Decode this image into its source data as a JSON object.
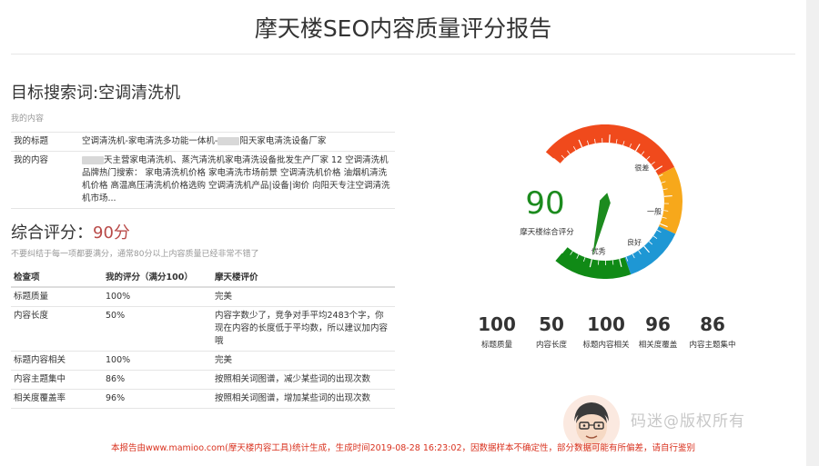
{
  "title": "摩天楼SEO内容质量评分报告",
  "keyword": {
    "label": "目标搜索词",
    "value": "空调清洗机"
  },
  "my_content_note": "我的内容",
  "content": {
    "title_label": "我的标题",
    "title_before": "空调清洗机-家电清洗多功能一体机-",
    "title_after": "阳天家电清洗设备厂家",
    "body_label": "我的内容",
    "body_before": "",
    "body_after": "天主营家电清洗机、蒸汽清洗机家电清洗设备批发生产厂家 12 空调清洗机品牌热门搜索： 家电清洗机价格 家电清洗市场前景 空调清洗机价格 油烟机清洗机价格 高温高压清洗机价格选购 空调清洗机产品|设备|询价 向阳天专注空调清洗机市场..."
  },
  "summary": {
    "label": "综合评分：",
    "value": "90分",
    "note": "不要纠结于每一项都要满分，通常80分以上内容质量已经非常不错了"
  },
  "table": {
    "headers": [
      "检查项",
      "我的评分（满分100）",
      "摩天楼评价"
    ],
    "rows": [
      {
        "item": "标题质量",
        "score": "100%",
        "comment": "完美"
      },
      {
        "item": "内容长度",
        "score": "50%",
        "comment": "内容字数少了，竞争对手平均2483个字，你现在内容的长度低于平均数，所以建议加内容哦"
      },
      {
        "item": "标题内容相关",
        "score": "100%",
        "comment": "完美"
      },
      {
        "item": "内容主题集中",
        "score": "86%",
        "comment": "按照相关词图谱，减少某些词的出现次数"
      },
      {
        "item": "相关度覆盖率",
        "score": "96%",
        "comment": "按照相关词图谱，增加某些词的出现次数"
      }
    ]
  },
  "gauge": {
    "value": 90,
    "value_text": "90",
    "label": "摩天楼综合评分",
    "segment_labels": [
      "很差",
      "一般",
      "良好",
      "优秀"
    ],
    "colors": {
      "very_bad": "#f04a1c",
      "average": "#f7a81b",
      "good": "#1e97d4",
      "excellent": "#108a16",
      "value": "#1c8b1e",
      "needle": "#1c8b1e"
    }
  },
  "metrics": [
    {
      "value": "100",
      "label": "标题质量"
    },
    {
      "value": "50",
      "label": "内容长度"
    },
    {
      "value": "100",
      "label": "标题内容相关"
    },
    {
      "value": "96",
      "label": "相关度覆盖"
    },
    {
      "value": "86",
      "label": "内容主题集中"
    }
  ],
  "footer": "本报告由www.mamioo.com(摩天楼内容工具)统计生成，生成时间2019-08-28 16:23:02，因数据样本不确定性，部分数据可能有所偏差，请自行鉴别",
  "brand": "码迷@版权所有"
}
